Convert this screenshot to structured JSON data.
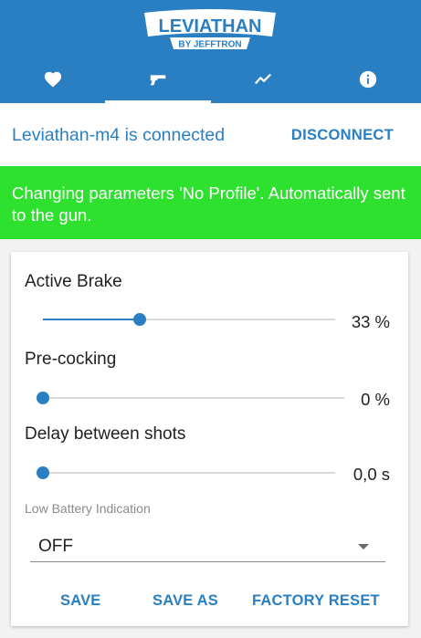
{
  "header": {
    "logo_title": "LEVIATHAN",
    "logo_subtitle": "BY JEFFTRON",
    "tabs": [
      {
        "icon": "heart-icon",
        "active": false
      },
      {
        "icon": "gun-icon",
        "active": true
      },
      {
        "icon": "chart-line-icon",
        "active": false
      },
      {
        "icon": "info-icon",
        "active": false
      }
    ]
  },
  "connection": {
    "status": "Leviathan-m4 is connected",
    "disconnect_label": "DISCONNECT"
  },
  "banner": {
    "text": "Changing parameters 'No Profile'. Automatically sent to the gun."
  },
  "settings": {
    "active_brake": {
      "label": "Active Brake",
      "value": 33,
      "value_text": "33 %"
    },
    "pre_cocking": {
      "label": "Pre-cocking",
      "value": 0,
      "value_text": "0 %"
    },
    "delay": {
      "label": "Delay between shots",
      "value": 0,
      "value_text": "0,0 s"
    },
    "low_battery": {
      "label": "Low Battery Indication",
      "selected": "OFF"
    }
  },
  "actions": {
    "save": "SAVE",
    "save_as": "SAVE AS",
    "factory_reset": "FACTORY RESET"
  },
  "colors": {
    "primary": "#2a7fc3",
    "banner": "#2fe12f"
  }
}
